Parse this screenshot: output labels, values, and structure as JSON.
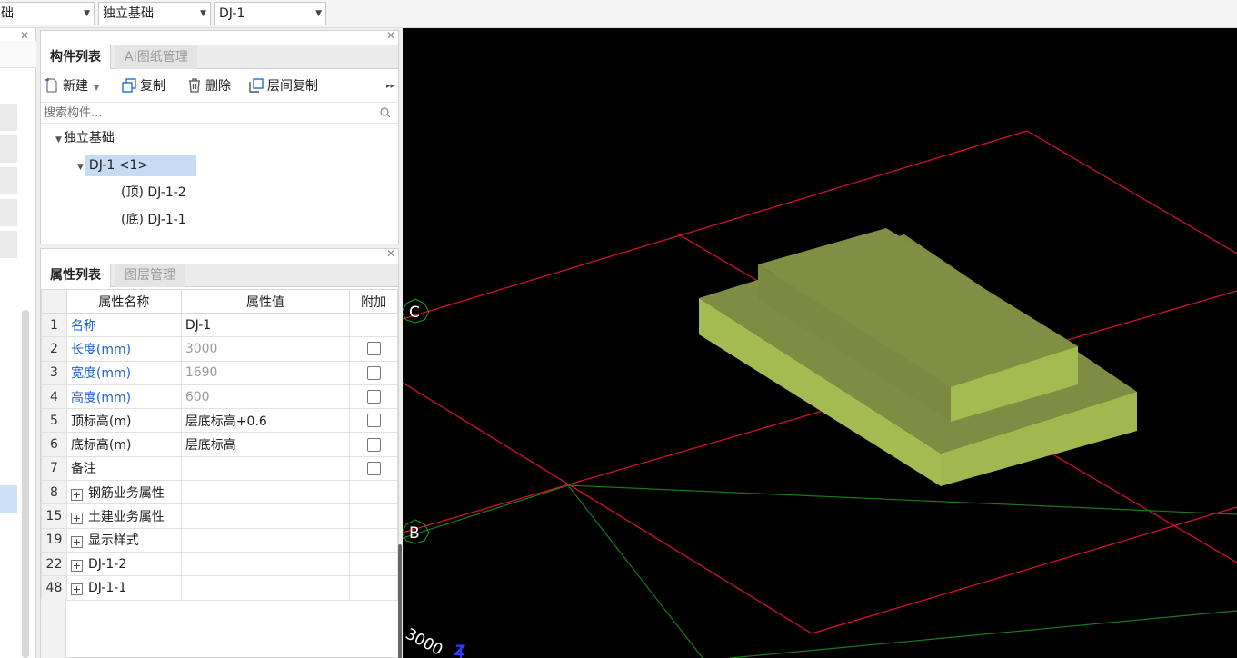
{
  "topbar": {
    "combo1": "础",
    "combo2": "独立基础",
    "combo3": "DJ-1"
  },
  "component_panel": {
    "tabs": [
      {
        "label": "构件列表"
      },
      {
        "label": "AI图纸管理"
      }
    ],
    "toolbar": {
      "new_label": "新建",
      "copy_label": "复制",
      "delete_label": "删除",
      "floor_copy_label": "层间复制"
    },
    "search_placeholder": "搜索构件...",
    "tree": {
      "root": "独立基础",
      "item": "DJ-1 <1>",
      "children": [
        "(顶) DJ-1-2",
        "(底) DJ-1-1"
      ]
    }
  },
  "property_panel": {
    "tabs": [
      {
        "label": "属性列表"
      },
      {
        "label": "图层管理"
      }
    ],
    "headers": {
      "name": "属性名称",
      "value": "属性值",
      "extra": "附加"
    },
    "rows": [
      {
        "num": "1",
        "name": "名称",
        "value": "DJ-1"
      },
      {
        "num": "2",
        "name": "长度(mm)",
        "value": "3000"
      },
      {
        "num": "3",
        "name": "宽度(mm)",
        "value": "1690"
      },
      {
        "num": "4",
        "name": "高度(mm)",
        "value": "600"
      },
      {
        "num": "5",
        "name": "顶标高(m)",
        "value": "层底标高+0.6"
      },
      {
        "num": "6",
        "name": "底标高(m)",
        "value": "层底标高"
      },
      {
        "num": "7",
        "name": "备注",
        "value": ""
      },
      {
        "num": "8",
        "name": "钢筋业务属性",
        "value": ""
      },
      {
        "num": "15",
        "name": "土建业务属性",
        "value": ""
      },
      {
        "num": "19",
        "name": "显示样式",
        "value": ""
      },
      {
        "num": "22",
        "name": "DJ-1-2",
        "value": ""
      },
      {
        "num": "48",
        "name": "DJ-1-1",
        "value": ""
      }
    ]
  },
  "viewport": {
    "axis_c": "C",
    "axis_b": "B",
    "dimension": "3000",
    "axis_z": "Z"
  },
  "colors": {
    "grid_red": "#e0102a",
    "grid_green": "#1a7a1a",
    "footing": "#a4bb52",
    "selection": "#c5dcf2",
    "blue_text": "#1e5fd6"
  }
}
